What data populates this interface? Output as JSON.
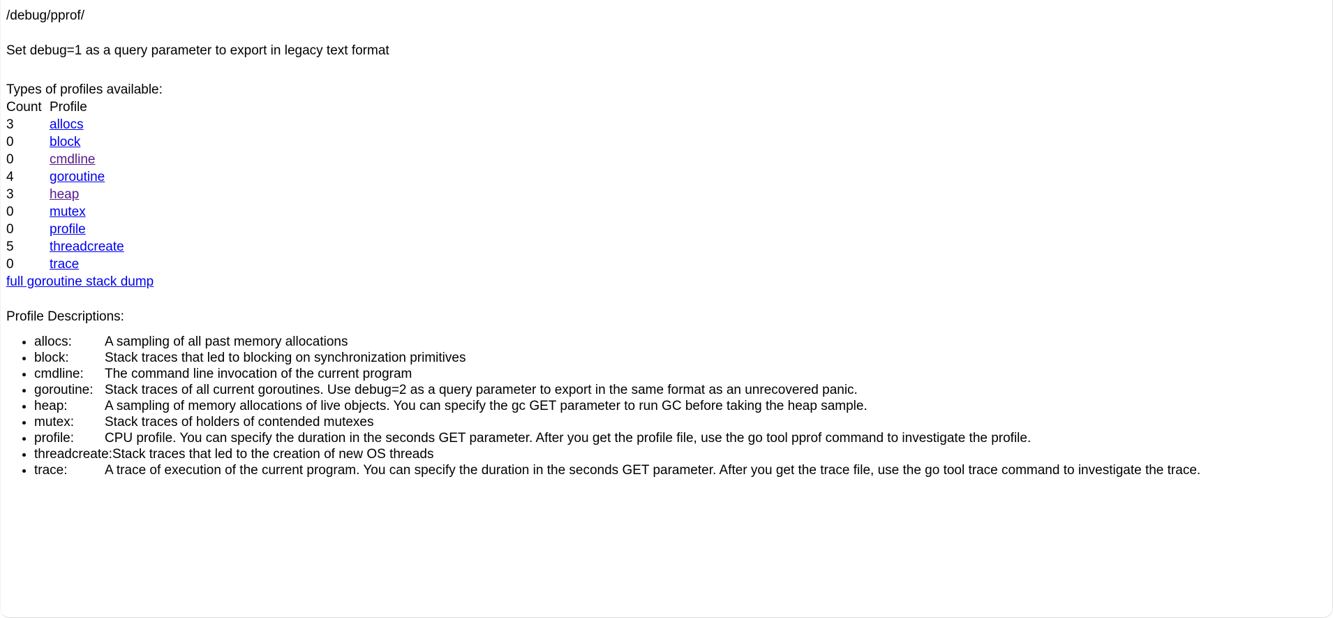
{
  "page": {
    "path_title": "/debug/pprof/",
    "debug_hint": "Set debug=1 as a query parameter to export in legacy text format",
    "types_heading": "Types of profiles available:",
    "descriptions_heading": "Profile Descriptions:"
  },
  "colors": {
    "link_unvisited": "#0000EE",
    "link_visited": "#551A8B",
    "text": "#000000",
    "background": "#FFFFFF"
  },
  "profile_table": {
    "headers": {
      "count": "Count",
      "profile": "Profile"
    },
    "rows": [
      {
        "count": "3",
        "name": "allocs",
        "state": "unvisited"
      },
      {
        "count": "0",
        "name": "block",
        "state": "unvisited"
      },
      {
        "count": "0",
        "name": "cmdline",
        "state": "visited"
      },
      {
        "count": "4",
        "name": "goroutine",
        "state": "unvisited"
      },
      {
        "count": "3",
        "name": "heap",
        "state": "visited"
      },
      {
        "count": "0",
        "name": "mutex",
        "state": "unvisited"
      },
      {
        "count": "0",
        "name": "profile",
        "state": "unvisited"
      },
      {
        "count": "5",
        "name": "threadcreate",
        "state": "unvisited"
      },
      {
        "count": "0",
        "name": "trace",
        "state": "unvisited"
      }
    ],
    "stack_dump_link": "full goroutine stack dump"
  },
  "descriptions": [
    {
      "label": "allocs:",
      "text": "A sampling of all past memory allocations"
    },
    {
      "label": "block:",
      "text": "Stack traces that led to blocking on synchronization primitives"
    },
    {
      "label": "cmdline:",
      "text": "The command line invocation of the current program"
    },
    {
      "label": "goroutine:",
      "text": "Stack traces of all current goroutines. Use debug=2 as a query parameter to export in the same format as an unrecovered panic."
    },
    {
      "label": "heap:",
      "text": "A sampling of memory allocations of live objects. You can specify the gc GET parameter to run GC before taking the heap sample."
    },
    {
      "label": "mutex:",
      "text": "Stack traces of holders of contended mutexes"
    },
    {
      "label": "profile:",
      "text": "CPU profile. You can specify the duration in the seconds GET parameter. After you get the profile file, use the go tool pprof command to investigate the profile."
    },
    {
      "label": "threadcreate:",
      "text": "Stack traces that led to the creation of new OS threads"
    },
    {
      "label": "trace:",
      "text": "A trace of execution of the current program. You can specify the duration in the seconds GET parameter. After you get the trace file, use the go tool trace command to investigate the trace."
    }
  ]
}
